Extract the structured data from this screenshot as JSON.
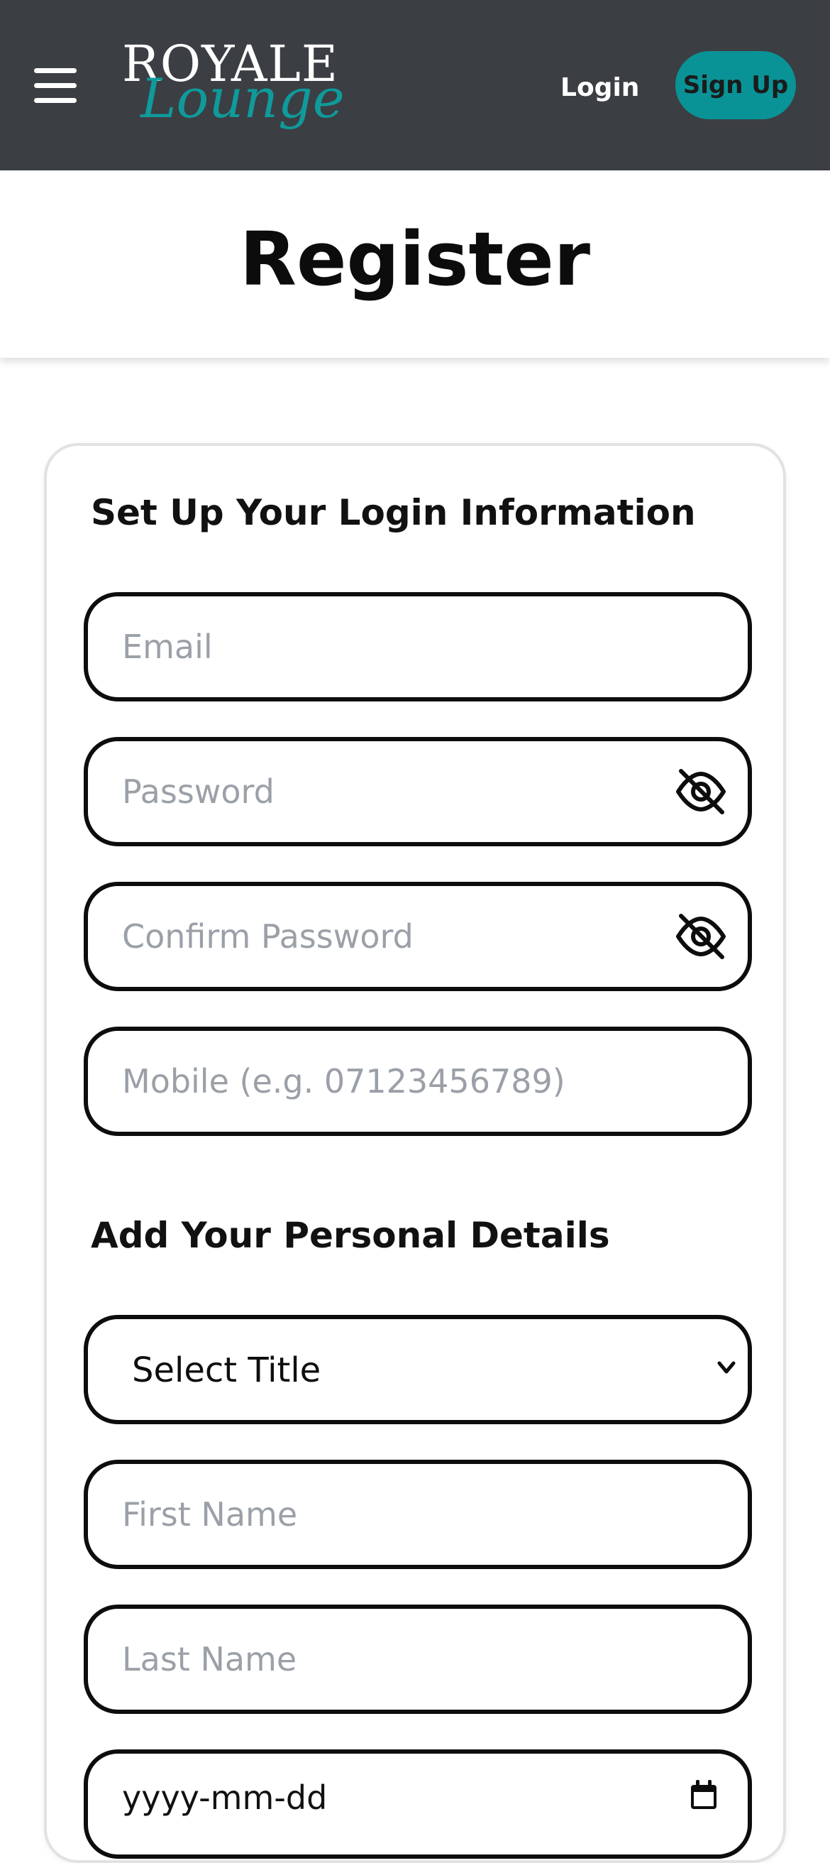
{
  "header": {
    "logo_top": "ROYALE",
    "logo_script": "Lounge",
    "login_label": "Login",
    "signup_label": "Sign Up",
    "menu_icon": "hamburger-icon"
  },
  "page": {
    "title": "Register"
  },
  "login_section": {
    "heading": "Set Up Your Login Information",
    "email_placeholder": "Email",
    "password_placeholder": "Password",
    "confirm_password_placeholder": "Confirm Password",
    "mobile_placeholder": "Mobile (e.g. 07123456789)",
    "password_toggle_icon": "eye-off-icon"
  },
  "personal_section": {
    "heading": "Add Your Personal Details",
    "title_select_value": "Select Title",
    "first_name_placeholder": "First Name",
    "last_name_placeholder": "Last Name",
    "dob_placeholder": "yyyy-mm-dd"
  },
  "colors": {
    "header_bg": "#3b3e43",
    "accent": "#0a9396",
    "field_border": "#0d0d0d",
    "placeholder": "#9ba0a8"
  }
}
